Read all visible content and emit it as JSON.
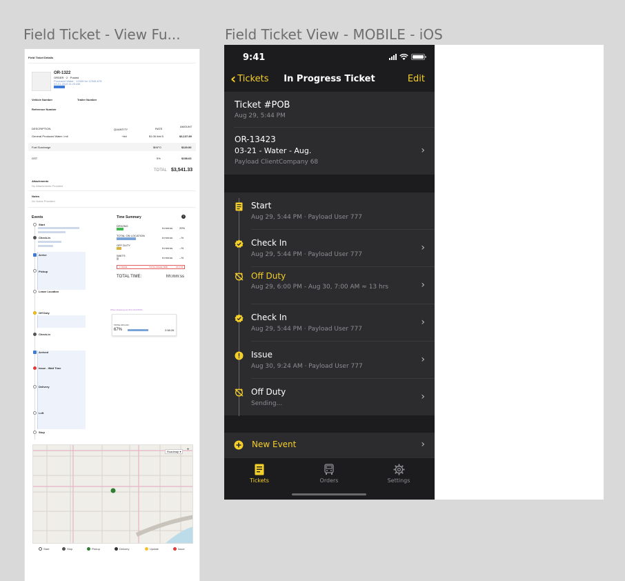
{
  "frames": {
    "desktop_title": "Field Ticket -  View Fu...",
    "mobile_title": "Field Ticket View - MOBILE - iOS"
  },
  "desktop": {
    "header": "Field Ticket Details",
    "order_number": "OR-1322",
    "order_sub": "ORDER · 2 · Posted",
    "order_product": "Produced Water · 12345 for 12345-678",
    "order_date": "03-21-2019 11:23 AM",
    "vehicle_label": "Vehicle Number",
    "trailer_label": "Trailer Number",
    "reference_label": "Reference Number",
    "columns": [
      "DESCRIPTION",
      "QUANTITY",
      "RATE",
      "AMOUNT"
    ],
    "line_items": [
      {
        "desc": "General Produced Water / mil",
        "qty": "~bbl",
        "rate": "$1.06 /bbl 5",
        "amount": "$3,137.89"
      },
      {
        "desc": "Fuel Surcharge",
        "qty": "",
        "rate": "$INFO",
        "amount": "$120.00"
      },
      {
        "desc": "GST",
        "qty": "",
        "rate": "5%",
        "amount": "$158.63"
      }
    ],
    "total_label": "TOTAL",
    "total_value": "$3,541.33",
    "attachments_label": "Attachments",
    "attachments_empty": "No Attachments Provided",
    "notes_label": "Notes",
    "notes_empty": "No Notes Provided",
    "events_label": "Events",
    "events": [
      "Start",
      "Check-In",
      "Arrive",
      "Pickup",
      "Leave Location",
      "Off Duty",
      "Check-in",
      "Arrived",
      "Issue - Wait Time",
      "Delivery",
      "Left",
      "Stop"
    ],
    "time_summary_label": "Time Summary",
    "time_rows": [
      {
        "label": "DRIVING",
        "value": "h:mm:ss",
        "pct": "20%",
        "color": "#3fb84f"
      },
      {
        "label": "TOTAL ON LOCATION",
        "value": "h:mm:ss",
        "pct": "--%",
        "color": "#7aa3d8"
      },
      {
        "label": "OFF DUTY",
        "value": "h:mm:ss",
        "pct": "--%",
        "color": "#d8b23a"
      },
      {
        "label": "WAITS",
        "value": "h:mm:ss",
        "pct": "--%",
        "color": "#bbbbbb"
      }
    ],
    "alert_issues": "1 ISSUE",
    "alert_total": "TOTAL ISSUE TIME",
    "alert_value": "07:4:78",
    "total_time_label": "TOTAL TIME:",
    "total_time_value": "hh:mm:ss",
    "popup_caption": "When showing just ON LOCATION",
    "popup_total": "TOTAL ON LOC:",
    "popup_pct": "67%",
    "popup_time": "2:58:26",
    "legend": [
      {
        "label": "Start",
        "color": "#ffffff"
      },
      {
        "label": "Stop",
        "color": "#555555"
      },
      {
        "label": "Pickup",
        "color": "#2e7d32"
      },
      {
        "label": "Delivery",
        "color": "#333333"
      },
      {
        "label": "Update",
        "color": "#f2c12e"
      },
      {
        "label": "Issue",
        "color": "#e23b3b"
      }
    ]
  },
  "mobile": {
    "status_time": "9:41",
    "nav": {
      "back": "Tickets",
      "title": "In Progress Ticket",
      "edit": "Edit"
    },
    "ticket": {
      "title": "Ticket #POB",
      "date": "Aug 29, 5:44 PM"
    },
    "order": {
      "number": "OR-13423",
      "desc": "03-21 - Water - Aug.",
      "client": "Payload ClientCompany 68"
    },
    "events": [
      {
        "title": "Start",
        "sub": "Aug 29, 5:44 PM · Payload User 777",
        "icon": "ticket-icon",
        "color": "#f5cf2b",
        "chevron": false
      },
      {
        "title": "Check In",
        "sub": "Aug 29, 5:44 PM · Payload User 777",
        "icon": "check-badge-icon",
        "color": "#f5cf2b",
        "chevron": true
      },
      {
        "title": "Off Duty",
        "sub": "Aug 29, 6:00 PM - Aug 30, 7:00 AM ≈ 13 hrs",
        "icon": "alarm-off-icon",
        "color": "#f5cf2b",
        "chevron": true
      },
      {
        "title": "Check In",
        "sub": "Aug 29, 5:44 PM · Payload User 777",
        "icon": "check-badge-icon",
        "color": "#f5cf2b",
        "chevron": true
      },
      {
        "title": "Issue",
        "sub": "Aug 30, 9:24 AM · Payload User 777",
        "icon": "alert-icon",
        "color": "#f5cf2b",
        "chevron": true
      },
      {
        "title": "Off Duty",
        "sub": "Sending...",
        "icon": "alarm-off-icon",
        "color": "#f5cf2b",
        "chevron": true
      }
    ],
    "new_event": "New Event",
    "tabs": [
      {
        "label": "Tickets",
        "icon": "ticket-icon",
        "active": true
      },
      {
        "label": "Orders",
        "icon": "truck-icon",
        "active": false
      },
      {
        "label": "Settings",
        "icon": "gear-icon",
        "active": false
      }
    ],
    "accent": "#f5cf2b"
  }
}
